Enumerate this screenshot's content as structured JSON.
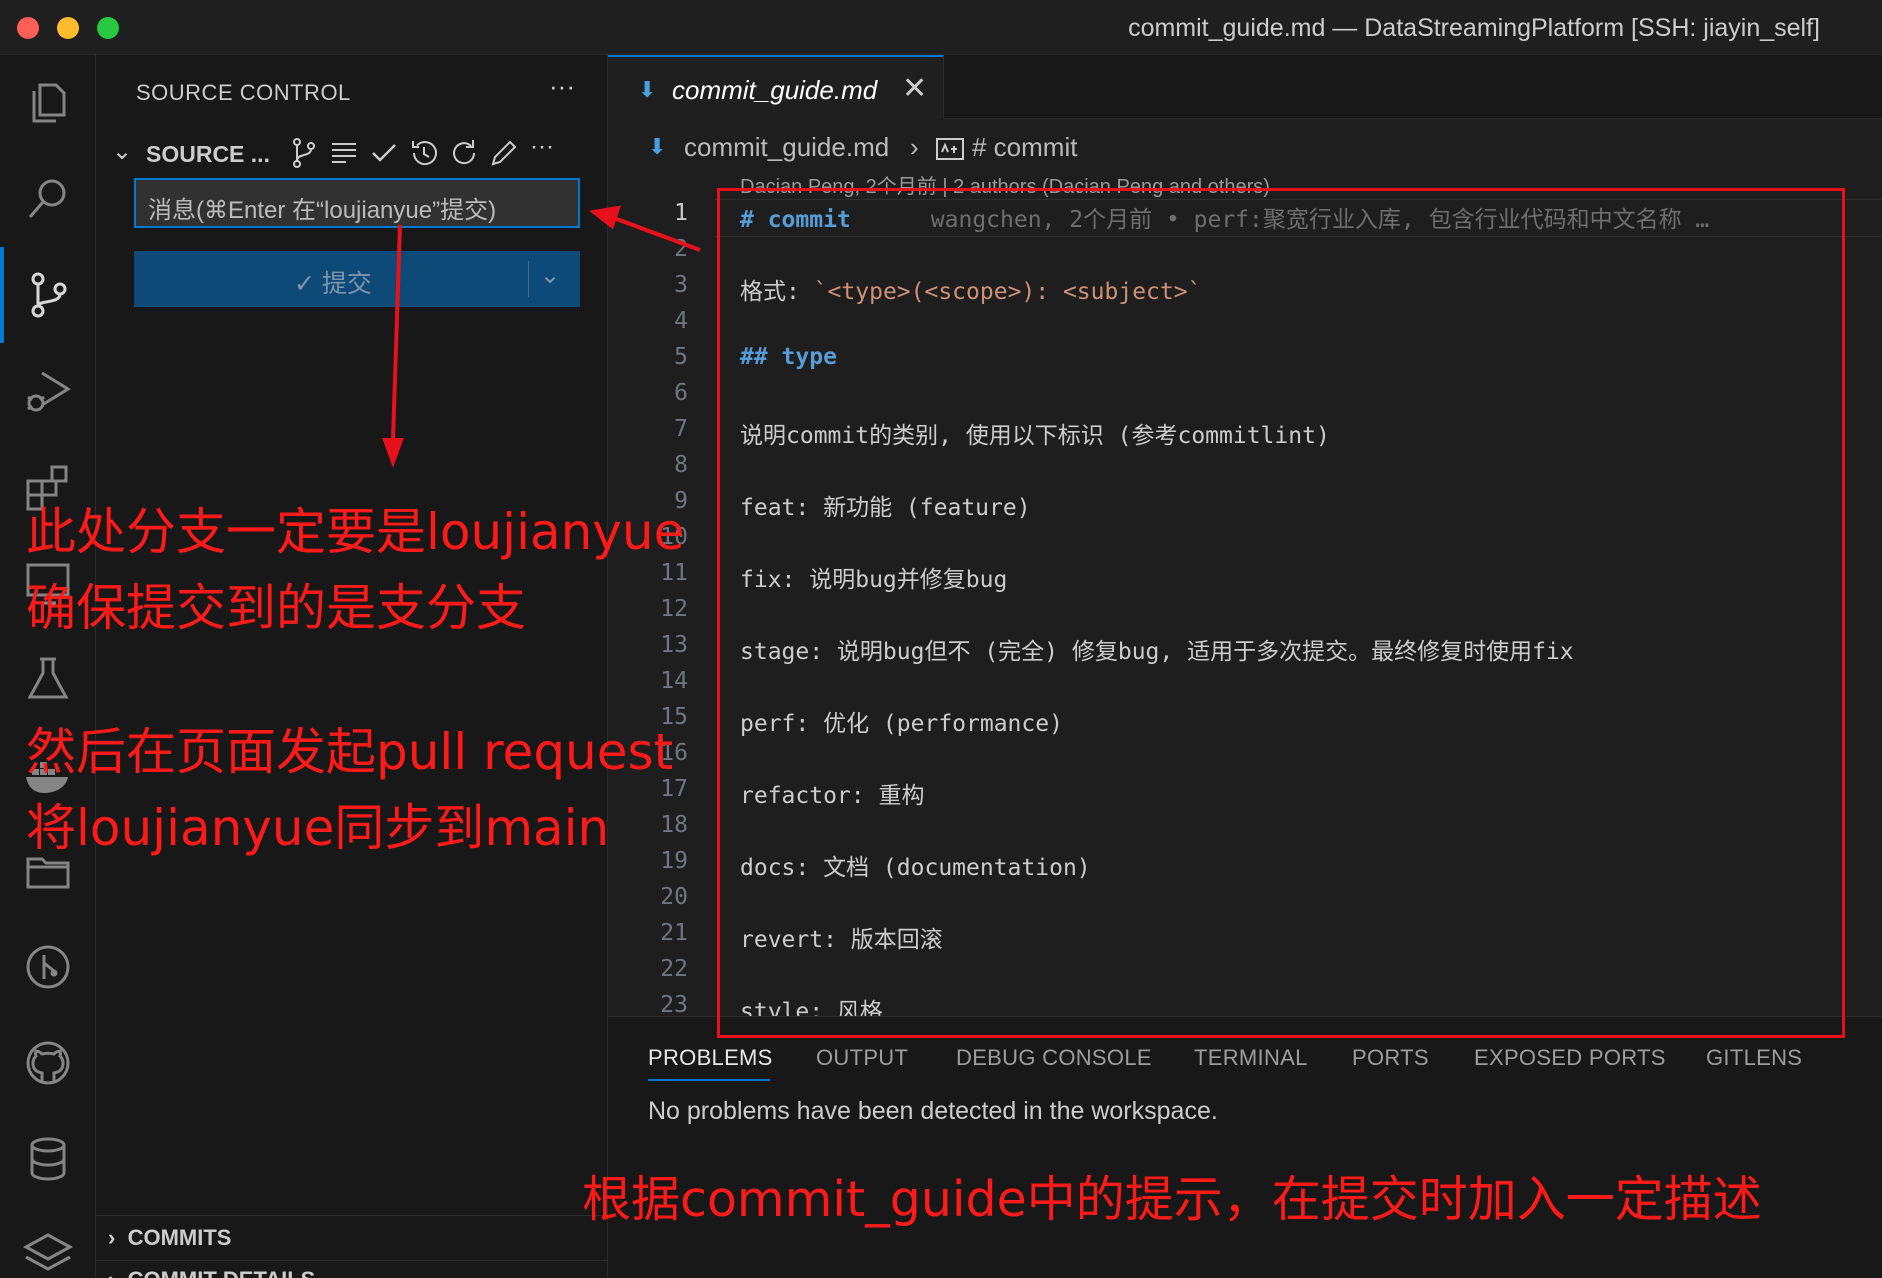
{
  "window": {
    "title": "commit_guide.md — DataStreamingPlatform [SSH: jiayin_self]"
  },
  "activity_bar": {
    "icons": [
      "explorer-icon",
      "search-icon",
      "source-control-icon",
      "run-debug-icon",
      "extensions-icon",
      "remote-explorer-icon",
      "testing-icon",
      "docker-icon",
      "folder-icon",
      "git-graph-icon",
      "github-icon",
      "database-icon",
      "layers-icon"
    ]
  },
  "sidebar": {
    "title": "SOURCE CONTROL",
    "more": "···",
    "section_label": "SOURCE ...",
    "section_more": "···",
    "message_placeholder": "消息(⌘Enter 在“loujianyue”提交)",
    "commit_label": "✓ 提交",
    "commit_dropdown": "⌄",
    "bottom_sections": [
      "COMMITS",
      "COMMIT DETAILS"
    ]
  },
  "editor": {
    "tab_label": "commit_guide.md",
    "tab_close": "✕",
    "breadcrumb": {
      "file": "commit_guide.md",
      "separator": "›",
      "symbol": "# commit"
    },
    "codelens": "Dacian Peng, 2个月前 | 2 authors (Dacian Peng and others)",
    "blame": "wangchen, 2个月前 • perf:聚宽行业入库, 包含行业代码和中文名称 …",
    "current_line": 1,
    "lines": [
      {
        "n": "1",
        "text": "# commit"
      },
      {
        "n": "2",
        "text": ""
      },
      {
        "n": "3",
        "text": "格式: `<type>(<scope>): <subject>`"
      },
      {
        "n": "4",
        "text": ""
      },
      {
        "n": "5",
        "text": "## type"
      },
      {
        "n": "6",
        "text": ""
      },
      {
        "n": "7",
        "text": "说明commit的类别, 使用以下标识 (参考commitlint)"
      },
      {
        "n": "8",
        "text": ""
      },
      {
        "n": "9",
        "text": "feat: 新功能 (feature)"
      },
      {
        "n": "10",
        "text": ""
      },
      {
        "n": "11",
        "text": "fix: 说明bug并修复bug"
      },
      {
        "n": "12",
        "text": ""
      },
      {
        "n": "13",
        "text": "stage: 说明bug但不 (完全) 修复bug, 适用于多次提交。最终修复时使用fix"
      },
      {
        "n": "14",
        "text": ""
      },
      {
        "n": "15",
        "text": "perf: 优化 (performance)"
      },
      {
        "n": "16",
        "text": ""
      },
      {
        "n": "17",
        "text": "refactor: 重构"
      },
      {
        "n": "18",
        "text": ""
      },
      {
        "n": "19",
        "text": "docs: 文档 (documentation)"
      },
      {
        "n": "20",
        "text": ""
      },
      {
        "n": "21",
        "text": "revert: 版本回滚"
      },
      {
        "n": "22",
        "text": ""
      },
      {
        "n": "23",
        "text": "style: 风格"
      }
    ]
  },
  "panel": {
    "tabs": [
      "PROBLEMS",
      "OUTPUT",
      "DEBUG CONSOLE",
      "TERMINAL",
      "PORTS",
      "EXPOSED PORTS",
      "GITLENS"
    ],
    "active_tab": "PROBLEMS",
    "message": "No problems have been detected in the workspace."
  },
  "annotations": {
    "line1": "此处分支一定要是loujianyue",
    "line2": "确保提交到的是支分支",
    "line3": "然后在页面发起pull request",
    "line4": "将loujianyue同步到main",
    "line5": "根据commit_guide中的提示，在提交时加入一定描述",
    "color": "#ff1a1a"
  }
}
